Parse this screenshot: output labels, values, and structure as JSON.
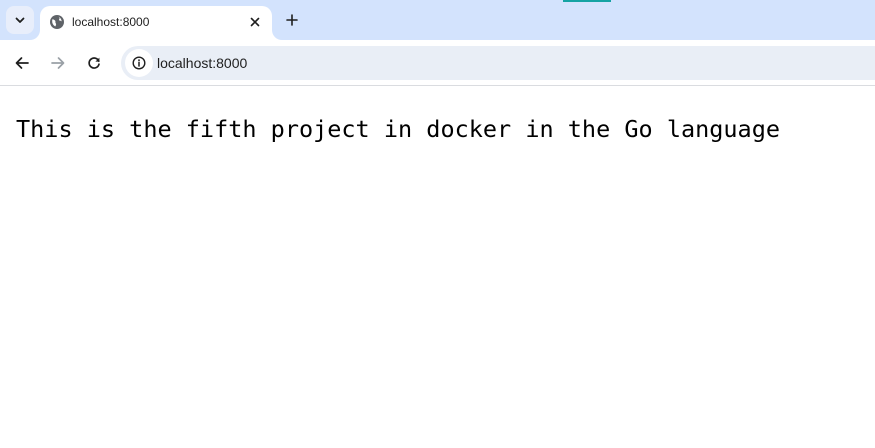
{
  "browser": {
    "tab": {
      "title": "localhost:8000",
      "favicon": "globe-icon",
      "close_icon": "close-icon"
    },
    "tab_search_icon": "chevron-down-icon",
    "new_tab_icon": "plus-icon",
    "toolbar": {
      "back_icon": "arrow-left-icon",
      "forward_icon": "arrow-right-icon",
      "reload_icon": "reload-icon",
      "site_info_icon": "info-icon",
      "url": "localhost:8000"
    },
    "colors": {
      "tabstrip_bg": "#d3e3fd",
      "omnibox_bg": "#e9eef6",
      "accent": "#15a3a3"
    }
  },
  "page": {
    "body_text": "This is the fifth project in docker in the Go language"
  }
}
